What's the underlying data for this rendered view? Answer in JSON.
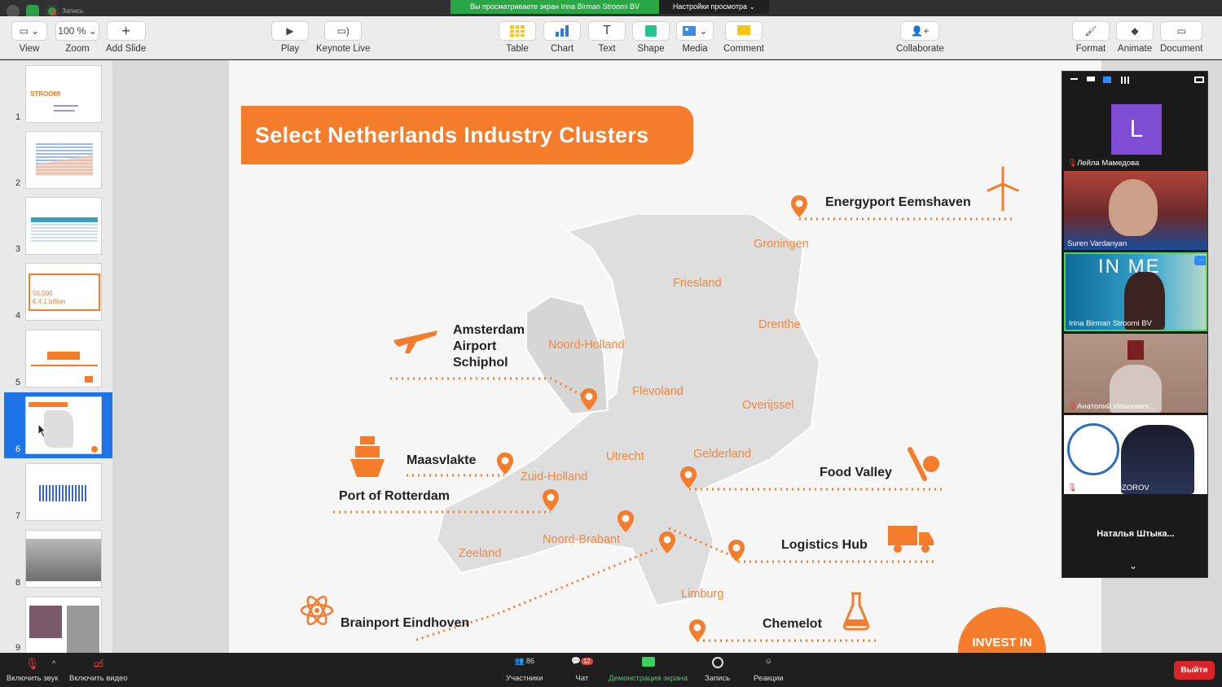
{
  "zoom_top": {
    "recording_label": "Запись",
    "share_banner": "Вы просматриваете экран Irina Birman Stroomi BV",
    "view_options": "Настройки просмотра"
  },
  "toolbar": {
    "view": "View",
    "zoom": "Zoom",
    "zoom_value": "100 %",
    "add_slide": "Add Slide",
    "play": "Play",
    "keynote_live": "Keynote Live",
    "table": "Table",
    "chart": "Chart",
    "text": "Text",
    "shape": "Shape",
    "media": "Media",
    "comment": "Comment",
    "collaborate": "Collaborate",
    "format": "Format",
    "animate": "Animate",
    "document": "Document"
  },
  "sidebar": {
    "slides": [
      "1",
      "2",
      "3",
      "4",
      "5",
      "6",
      "7",
      "8",
      "9"
    ],
    "selected": "6"
  },
  "slide": {
    "title": "Select Netherlands Industry Clusters",
    "clusters": {
      "energyport": "Energyport Eemshaven",
      "amsterdam": [
        "Amsterdam",
        "Airport",
        "Schiphol"
      ],
      "maasvlakte": "Maasvlakte",
      "rotterdam": "Port of Rotterdam",
      "food_valley": "Food Valley",
      "logistics": "Logistics Hub",
      "brainport": "Brainport Eindhoven",
      "chemelot": "Chemelot"
    },
    "provinces": {
      "groningen": "Groningen",
      "friesland": "Friesland",
      "drenthe": "Drenthe",
      "noord_holland": "Noord-Holland",
      "flevoland": "Flevoland",
      "overijssel": "Overijssel",
      "utrecht": "Utrecht",
      "gelderland": "Gelderland",
      "zuid_holland": "Zuid-Holland",
      "noord_brabant": "Noord-Brabant",
      "zeeland": "Zeeland",
      "limburg": "Limburg"
    },
    "invest": "INVEST IN",
    "accent_color": "#f47c2a"
  },
  "participants": {
    "tiles": [
      {
        "name": "Лейла Мамедова",
        "initial": "L"
      },
      {
        "name": "Suren Vardanyan"
      },
      {
        "name": "Irina Birman Stroomi BV",
        "bg_text": "IN ME"
      },
      {
        "name": "Анатолий Иванович..."
      },
      {
        "name": "Oleg B. PROZOROV"
      },
      {
        "name": "Наталья  Штыка..."
      }
    ]
  },
  "bottom": {
    "mute": "Включить звук",
    "video": "Включить видео",
    "participants": "Участники",
    "participant_count": "86",
    "chat": "Чат",
    "chat_badge": "12",
    "share": "Демонстрация экрана",
    "record": "Запись",
    "reactions": "Реакции",
    "leave": "Выйти"
  }
}
